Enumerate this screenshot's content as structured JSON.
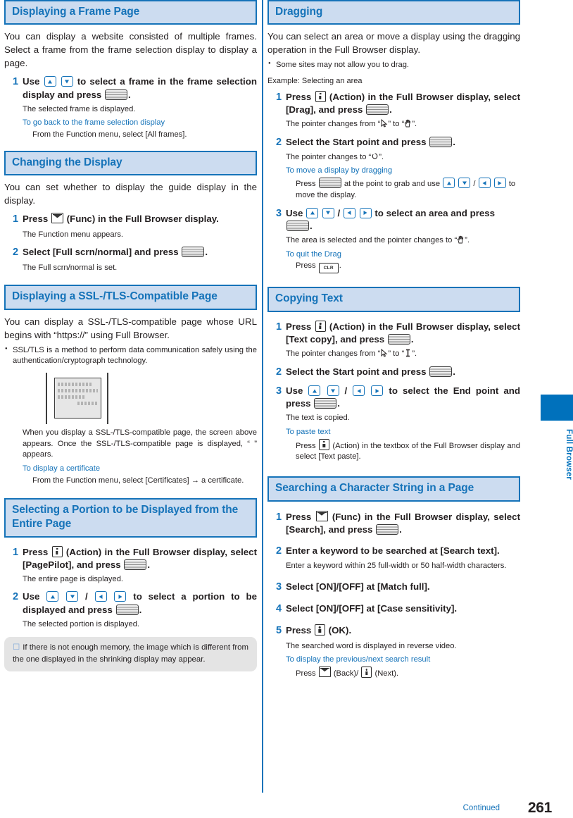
{
  "page": {
    "number": "261",
    "continued_label": "Continued",
    "side_tab_label": "Full Browser"
  },
  "left_column": {
    "sections": [
      {
        "id": "displaying-a-frame-page",
        "heading": "Displaying a Frame Page",
        "intro": "You can display a website consisted of multiple frames. Select a frame from the frame selection display to display a page.",
        "steps": [
          {
            "num": "1",
            "text_pre": "Use",
            "text_mid": "to select a frame in the frame selection display and press",
            "text_post": ".",
            "result": "The selected frame is displayed.",
            "subhead": "To go back to the frame selection display",
            "subbody": "From the Function menu, select [All frames]."
          }
        ]
      },
      {
        "id": "changing-the-display",
        "heading": "Changing the Display",
        "intro": "You can set whether to display the guide display in the display.",
        "steps": [
          {
            "num": "1",
            "text_pre": "Press",
            "text_mid": "(Func) in the Full Browser display.",
            "result": "The Function menu appears."
          },
          {
            "num": "2",
            "text_pre": "Select [Full scrn/normal] and press",
            "text_post": ".",
            "result": "The Full scrn/normal is set."
          }
        ]
      },
      {
        "id": "displaying-ssl-tls-page",
        "heading": "Displaying a SSL-/TLS-Compatible Page",
        "intro": "You can display a SSL-/TLS-compatible page whose URL begins with “https://” using Full Browser.",
        "bullet": "SSL/TLS is a method to perform data communication safely using the authentication/cryptograph technology.",
        "mock_caption": "When you display a SSL-/TLS-compatible page, the screen above appears. Once the SSL-/TLS-compatible page is displayed, “ ” appears.",
        "subhead": "To display a certificate",
        "subbody": "From the Function menu, select [Certificates] → a certificate."
      },
      {
        "id": "selecting-a-portion",
        "heading": "Selecting a Portion to be Displayed from the Entire Page",
        "steps": [
          {
            "num": "1",
            "text_pre": "Press",
            "text_mid": "(Action) in the Full Browser display, select [PagePilot], and press",
            "text_post": ".",
            "result": "The entire page is displayed."
          },
          {
            "num": "2",
            "text_pre": "Use",
            "text_mid": "to select a portion to be displayed and press",
            "text_post": ".",
            "result": "The selected portion is displayed."
          }
        ],
        "note": "If there is not enough memory, the image which is different from the one displayed in the shrinking display may appear."
      }
    ]
  },
  "right_column": {
    "sections": [
      {
        "id": "dragging",
        "heading": "Dragging",
        "intro": "You can select an area or move a display using the dragging operation in the Full Browser display.",
        "bullet": "Some sites may not allow you to drag.",
        "example_label": "Example: Selecting an area",
        "steps": [
          {
            "num": "1",
            "text_pre": "Press",
            "text_mid": "(Action) in the Full Browser display, select [Drag], and press",
            "text_post": ".",
            "result_pre": "The pointer changes from “",
            "result_mid": "” to “",
            "result_post": "”."
          },
          {
            "num": "2",
            "text_pre": "Select the Start point and press",
            "text_post": ".",
            "result_pre": "The pointer changes to “",
            "result_post": "”.",
            "subhead": "To move a display by dragging",
            "subbody_pre": "Press",
            "subbody_mid": "at the point to grab and use",
            "subbody_post": "to move the display."
          },
          {
            "num": "3",
            "text_pre": "Use",
            "text_mid": "to select an area and press",
            "text_post": ".",
            "result_pre": "The area is selected and the pointer changes to “",
            "result_post": "”.",
            "subhead": "To quit the Drag",
            "subbody_pre": "Press",
            "subbody_post": "."
          }
        ]
      },
      {
        "id": "copying-text",
        "heading": "Copying Text",
        "steps": [
          {
            "num": "1",
            "text_pre": "Press",
            "text_mid": "(Action) in the Full Browser display, select [Text copy], and press",
            "text_post": ".",
            "result_pre": "The pointer changes from “",
            "result_mid": "” to “",
            "result_post": "”."
          },
          {
            "num": "2",
            "text_pre": "Select the Start point and press",
            "text_post": "."
          },
          {
            "num": "3",
            "text_pre": "Use",
            "text_mid": "to select the End point and press",
            "text_post": ".",
            "result": "The text is copied.",
            "subhead": "To paste text",
            "subbody_pre": "Press",
            "subbody_post": "(Action) in the textbox of the Full Browser display and select [Text paste]."
          }
        ]
      },
      {
        "id": "searching-character-string",
        "heading": "Searching a Character String in a Page",
        "steps": [
          {
            "num": "1",
            "text_pre": "Press",
            "text_mid": "(Func) in the Full Browser display, select [Search], and press",
            "text_post": "."
          },
          {
            "num": "2",
            "text_pre": "Enter a keyword to be searched at [Search text].",
            "result": "Enter a keyword within 25 full-width or 50 half-width characters."
          },
          {
            "num": "3",
            "text_pre": "Select [ON]/[OFF] at [Match full]."
          },
          {
            "num": "4",
            "text_pre": "Select [ON]/[OFF] at [Case sensitivity]."
          },
          {
            "num": "5",
            "text_pre": "Press",
            "text_post": "(OK).",
            "result": "The searched word is displayed in reverse video.",
            "subhead": "To display the previous/next search result",
            "subbody_pre": "Press",
            "subbody_mid": "(Back)/",
            "subbody_post": "(Next)."
          }
        ]
      }
    ]
  }
}
